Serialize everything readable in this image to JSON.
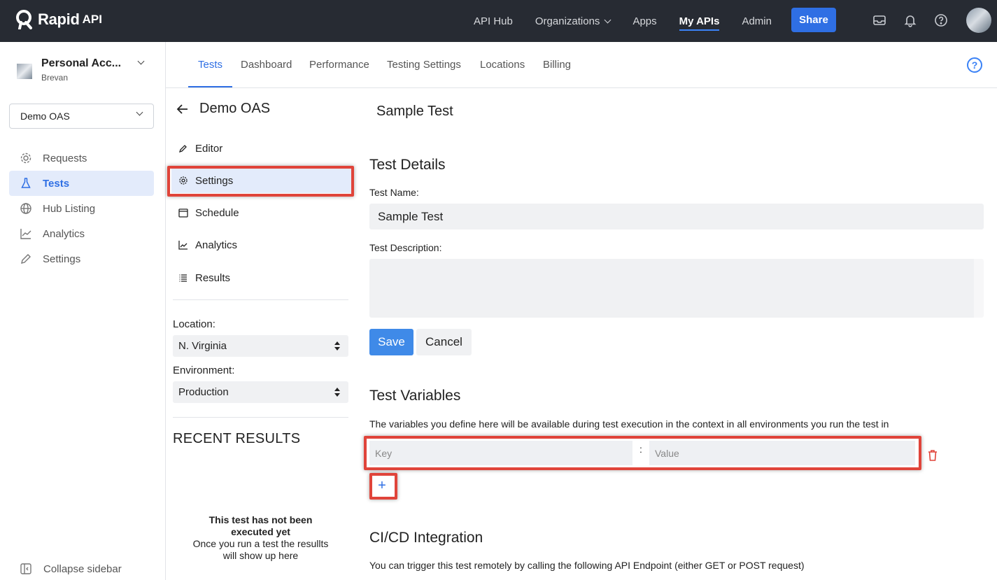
{
  "brand": {
    "name": "Rapid",
    "suffix": "API"
  },
  "topnav": {
    "items": [
      {
        "label": "API Hub"
      },
      {
        "label": "Organizations"
      },
      {
        "label": "Apps"
      },
      {
        "label": "My APIs"
      },
      {
        "label": "Admin"
      }
    ],
    "active": "My APIs",
    "share_label": "Share"
  },
  "account": {
    "name": "Personal Acc...",
    "sub": "Brevan"
  },
  "api_select": {
    "value": "Demo OAS"
  },
  "sidebar": {
    "items": [
      {
        "label": "Requests",
        "icon": "requests-icon"
      },
      {
        "label": "Tests",
        "icon": "flask-icon"
      },
      {
        "label": "Hub Listing",
        "icon": "globe-icon"
      },
      {
        "label": "Analytics",
        "icon": "chart-icon"
      },
      {
        "label": "Settings",
        "icon": "pencil-icon"
      }
    ],
    "active": "Tests",
    "collapse_label": "Collapse sidebar"
  },
  "tabs": {
    "items": [
      {
        "label": "Tests"
      },
      {
        "label": "Dashboard"
      },
      {
        "label": "Performance"
      },
      {
        "label": "Testing Settings"
      },
      {
        "label": "Locations"
      },
      {
        "label": "Billing"
      }
    ],
    "active": "Tests",
    "help_symbol": "?"
  },
  "test_panel": {
    "title": "Demo OAS",
    "items": [
      {
        "label": "Editor",
        "icon": "pencil-icon"
      },
      {
        "label": "Settings",
        "icon": "gear-icon"
      },
      {
        "label": "Schedule",
        "icon": "calendar-icon"
      },
      {
        "label": "Analytics",
        "icon": "chart-icon"
      },
      {
        "label": "Results",
        "icon": "list-icon"
      }
    ],
    "active": "Settings",
    "location_label": "Location:",
    "location_value": "N. Virginia",
    "environment_label": "Environment:",
    "environment_value": "Production",
    "recent_title": "RECENT RESULTS",
    "empty_bold": "This test has not been executed yet",
    "empty_text": "Once you run a test the resullts will show up here"
  },
  "main": {
    "page_title": "Sample Test",
    "details_heading": "Test Details",
    "name_label": "Test Name:",
    "name_value": "Sample Test",
    "desc_label": "Test Description:",
    "save_label": "Save",
    "cancel_label": "Cancel",
    "variables_heading": "Test Variables",
    "variables_text": "The variables you define here will be available during test execution in the context in all environments you run the test in",
    "key_placeholder": "Key",
    "value_placeholder": "Value",
    "kv_separator": ":",
    "add_symbol": "+",
    "cicd_heading": "CI/CD Integration",
    "cicd_text": "You can trigger this test remotely by calling the following API Endpoint (either GET or POST request)"
  },
  "colors": {
    "accent": "#2f6fe4",
    "topbar": "#272b33",
    "highlight": "#e0443a"
  }
}
